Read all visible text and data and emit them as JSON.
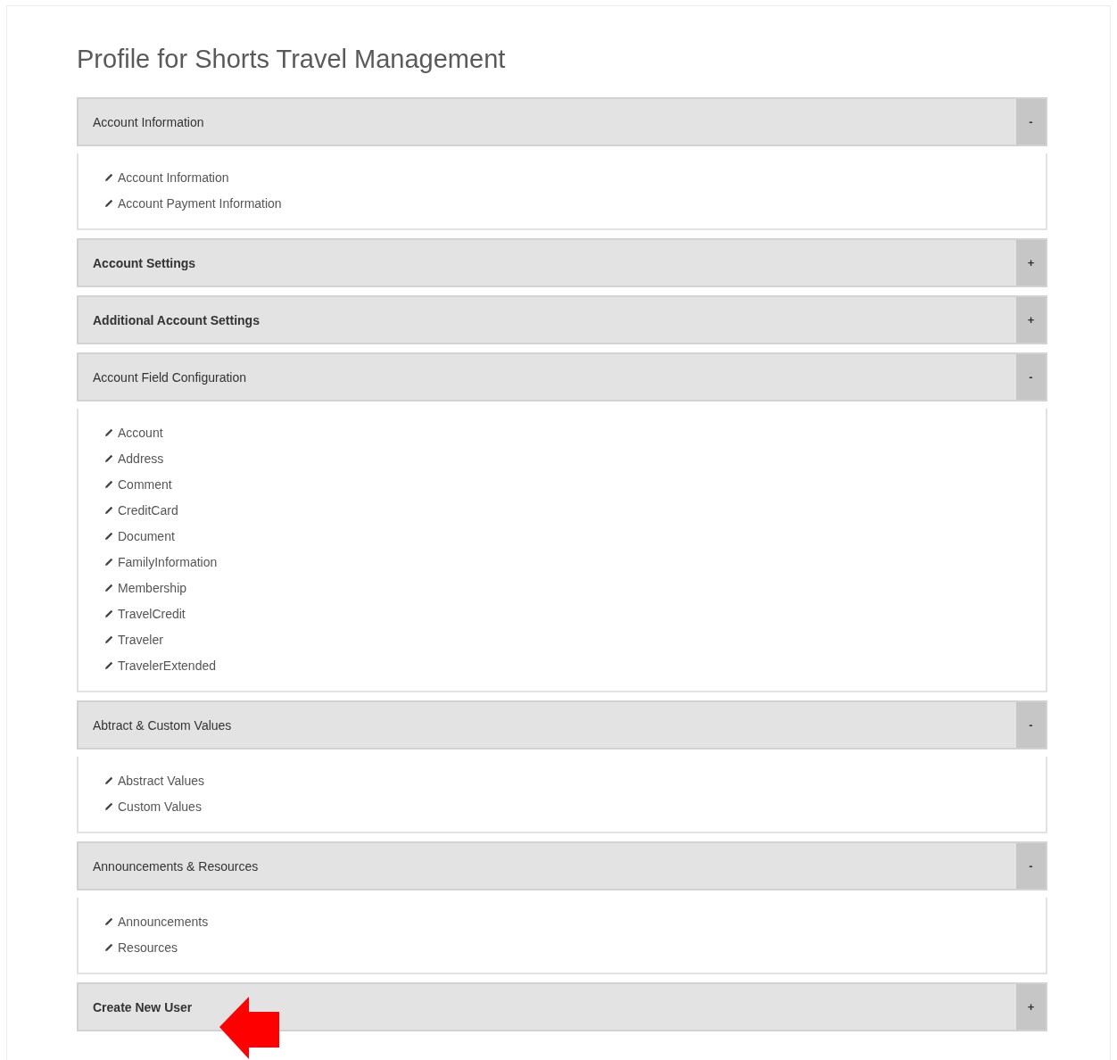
{
  "title": "Profile for Shorts Travel Management",
  "sections": [
    {
      "title": "Account Information",
      "toggle": "-",
      "expanded": true,
      "items": [
        "Account Information",
        "Account Payment Information"
      ]
    },
    {
      "title": "Account Settings",
      "toggle": "+",
      "expanded": false
    },
    {
      "title": "Additional Account Settings",
      "toggle": "+",
      "expanded": false
    },
    {
      "title": "Account Field Configuration",
      "toggle": "-",
      "expanded": true,
      "items": [
        "Account",
        "Address",
        "Comment",
        "CreditCard",
        "Document",
        "FamilyInformation",
        "Membership",
        "TravelCredit",
        "Traveler",
        "TravelerExtended"
      ]
    },
    {
      "title": "Abtract & Custom Values",
      "toggle": "-",
      "expanded": true,
      "items": [
        "Abstract Values",
        "Custom Values"
      ]
    },
    {
      "title": "Announcements & Resources",
      "toggle": "-",
      "expanded": true,
      "items": [
        "Announcements",
        "Resources"
      ]
    },
    {
      "title": "Create New User",
      "toggle": "+",
      "expanded": false,
      "pointer": true
    }
  ]
}
